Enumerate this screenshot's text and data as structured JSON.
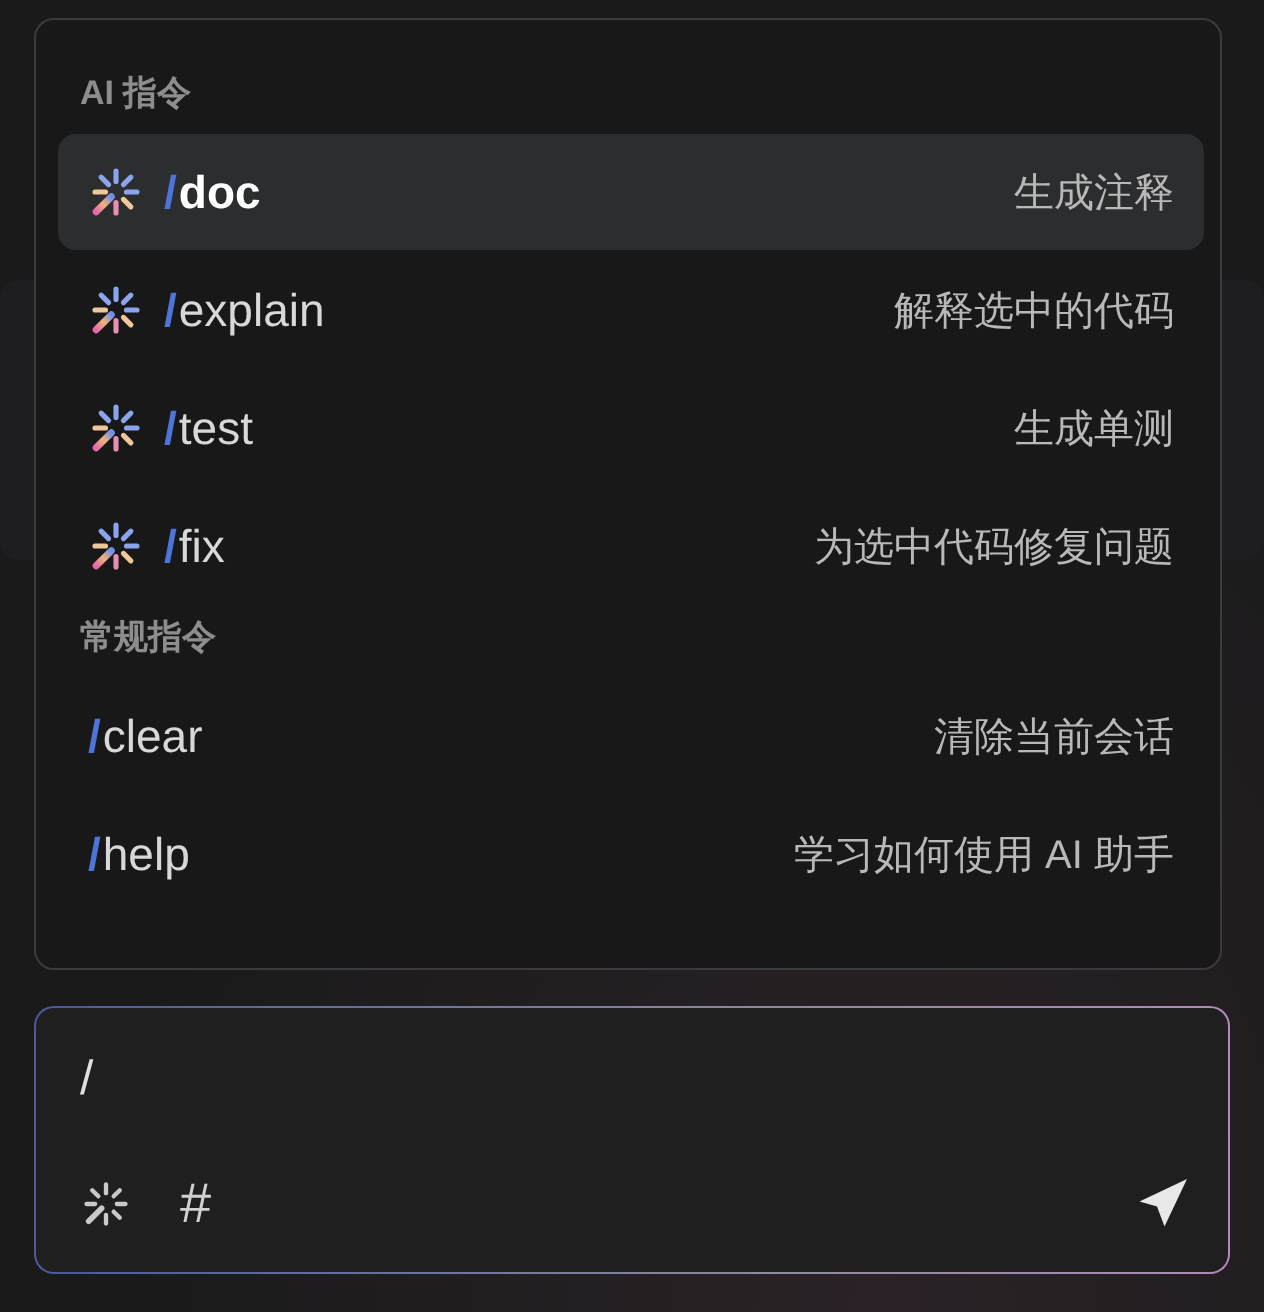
{
  "command_menu": {
    "sections": [
      {
        "title": "AI 指令",
        "kind": "ai",
        "items": [
          {
            "command": "/doc",
            "description": "生成注释",
            "selected": true
          },
          {
            "command": "/explain",
            "description": "解释选中的代码",
            "selected": false
          },
          {
            "command": "/test",
            "description": "生成单测",
            "selected": false
          },
          {
            "command": "/fix",
            "description": "为选中代码修复问题",
            "selected": false
          }
        ]
      },
      {
        "title": "常规指令",
        "kind": "general",
        "items": [
          {
            "command": "/clear",
            "description": "清除当前会话",
            "selected": false
          },
          {
            "command": "/help",
            "description": "学习如何使用 AI 助手",
            "selected": false
          }
        ]
      }
    ]
  },
  "input": {
    "value": "/",
    "hash_label": "#"
  }
}
